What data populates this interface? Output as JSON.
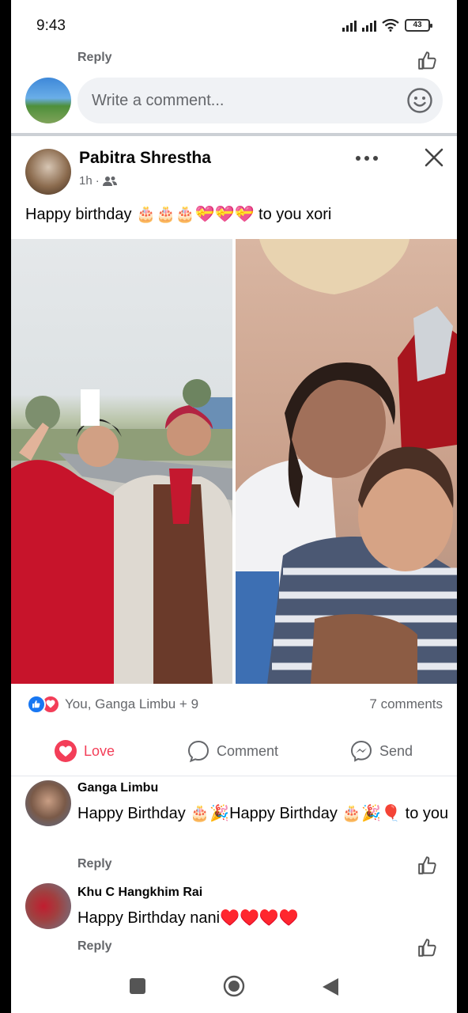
{
  "status_bar": {
    "time": "9:43",
    "battery": "43"
  },
  "top": {
    "reply_label": "Reply",
    "comment_placeholder": "Write a comment..."
  },
  "post": {
    "author": "Pabitra Shrestha",
    "time": "1h",
    "privacy_icon": "friends-icon",
    "text": "Happy birthday 🎂🎂🎂💝💝💝 to you xori"
  },
  "reactions": {
    "summary": "You, Ganga Limbu + 9",
    "comments": "7 comments"
  },
  "actions": {
    "love": "Love",
    "comment": "Comment",
    "send": "Send"
  },
  "comments": [
    {
      "name": "Ganga Limbu",
      "text": "Happy Birthday 🎂🎉Happy Birthday 🎂🎉🎈 to you",
      "reply": "Reply"
    },
    {
      "name": "Khu C Hangkhim Rai",
      "text": "Happy Birthday nani♥️♥️♥️♥️",
      "reply": "Reply"
    }
  ],
  "colors": {
    "accent_blue": "#1877f2",
    "love_red": "#f33e58",
    "secondary_text": "#65676b"
  }
}
